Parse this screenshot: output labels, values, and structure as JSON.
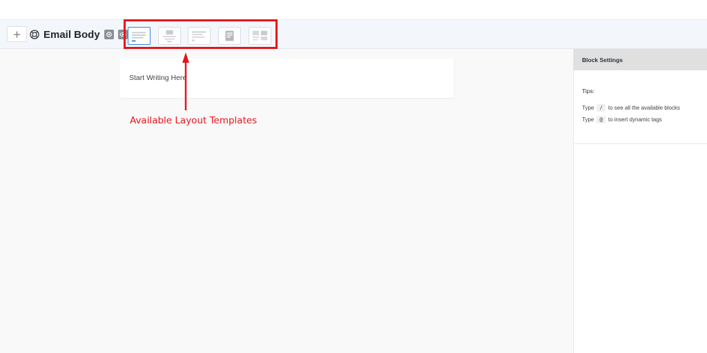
{
  "toolbar": {
    "add_label": "+",
    "title": "Email Body",
    "title_icon": "lifebuoy-icon",
    "settings_icon": "gear-icon",
    "preview_icon": "eye-icon"
  },
  "templates": {
    "items": [
      {
        "name": "template-plain-text",
        "selected": true
      },
      {
        "name": "template-image-centered",
        "selected": false
      },
      {
        "name": "template-text-left",
        "selected": false
      },
      {
        "name": "template-note",
        "selected": false
      },
      {
        "name": "template-image-grid",
        "selected": false
      }
    ],
    "highlight_color": "#e5141b",
    "selected_color": "#2f85e0"
  },
  "canvas": {
    "placeholder": "Start Writing Here"
  },
  "annotation": {
    "label": "Available Layout Templates",
    "color": "#e5141b"
  },
  "sidebar": {
    "header": "Block Settings",
    "tips_title": "Tips:",
    "tip1": {
      "prefix": "Type",
      "key": "/",
      "suffix": "to see all the available blocks"
    },
    "tip2": {
      "prefix": "Type",
      "key": "@",
      "suffix": "to insert dynamic tags"
    }
  }
}
